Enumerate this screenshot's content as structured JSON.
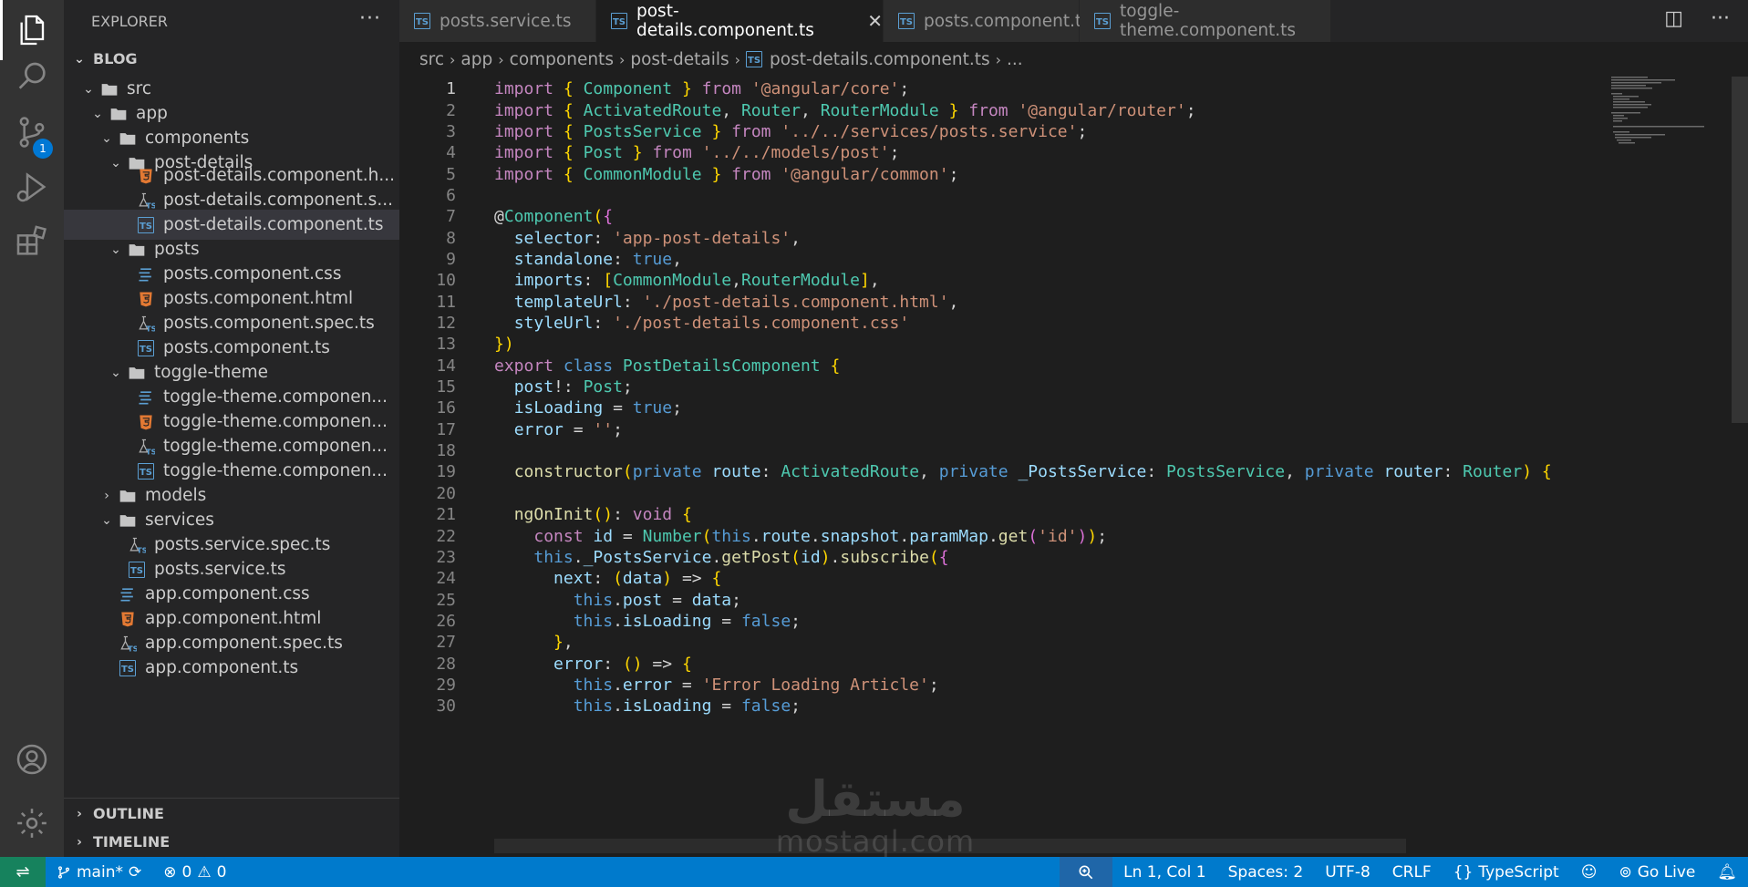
{
  "sidebar": {
    "title": "EXPLORER",
    "more": "···",
    "project": "BLOG",
    "tree": [
      {
        "label": "src",
        "kind": "folder-open"
      },
      {
        "label": "app",
        "kind": "folder-open"
      },
      {
        "label": "components",
        "kind": "folder-open"
      },
      {
        "label": "post-details",
        "kind": "folder-open"
      },
      {
        "label": "post-details.component.h...",
        "kind": "html"
      },
      {
        "label": "post-details.component.s...",
        "kind": "spec"
      },
      {
        "label": "post-details.component.ts",
        "kind": "ts",
        "selected": true
      },
      {
        "label": "posts",
        "kind": "folder-open"
      },
      {
        "label": "posts.component.css",
        "kind": "css"
      },
      {
        "label": "posts.component.html",
        "kind": "html"
      },
      {
        "label": "posts.component.spec.ts",
        "kind": "spec"
      },
      {
        "label": "posts.component.ts",
        "kind": "ts"
      },
      {
        "label": "toggle-theme",
        "kind": "folder-open"
      },
      {
        "label": "toggle-theme.componen...",
        "kind": "css"
      },
      {
        "label": "toggle-theme.componen...",
        "kind": "html"
      },
      {
        "label": "toggle-theme.componen...",
        "kind": "spec"
      },
      {
        "label": "toggle-theme.componen...",
        "kind": "ts"
      },
      {
        "label": "models",
        "kind": "folder-closed"
      },
      {
        "label": "services",
        "kind": "folder-open"
      },
      {
        "label": "posts.service.spec.ts",
        "kind": "spec"
      },
      {
        "label": "posts.service.ts",
        "kind": "ts"
      },
      {
        "label": "app.component.css",
        "kind": "css"
      },
      {
        "label": "app.component.html",
        "kind": "html"
      },
      {
        "label": "app.component.spec.ts",
        "kind": "spec"
      },
      {
        "label": "app.component.ts",
        "kind": "ts"
      }
    ],
    "outline": "OUTLINE",
    "timeline": "TIMELINE"
  },
  "tabs": [
    {
      "label": "posts.service.ts",
      "active": false
    },
    {
      "label": "post-details.component.ts",
      "active": true
    },
    {
      "label": "posts.component.ts",
      "active": false
    },
    {
      "label": "toggle-theme.component.ts",
      "active": false
    }
  ],
  "breadcrumb": [
    "src",
    "app",
    "components",
    "post-details",
    "post-details.component.ts",
    "..."
  ],
  "activity": {
    "scm_badge": "1"
  },
  "code_lines": [
    "import { Component } from '@angular/core';",
    "import { ActivatedRoute, Router, RouterModule } from '@angular/router';",
    "import { PostsService } from '../../services/posts.service';",
    "import { Post } from '../../models/post';",
    "import { CommonModule } from '@angular/common';",
    "",
    "@Component({",
    "  selector: 'app-post-details',",
    "  standalone: true,",
    "  imports: [CommonModule,RouterModule],",
    "  templateUrl: './post-details.component.html',",
    "  styleUrl: './post-details.component.css'",
    "})",
    "export class PostDetailsComponent {",
    "  post!: Post;",
    "  isLoading = true;",
    "  error = '';",
    "",
    "  constructor(private route: ActivatedRoute, private _PostsService: PostsService, private router: Router) {",
    "",
    "  ngOnInit(): void {",
    "    const id = Number(this.route.snapshot.paramMap.get('id'));",
    "    this._PostsService.getPost(id).subscribe({",
    "      next: (data) => {",
    "        this.post = data;",
    "        this.isLoading = false;",
    "      },",
    "      error: () => {",
    "        this.error = 'Error Loading Article';",
    "        this.isLoading = false;"
  ],
  "watermark": {
    "arabic": "مستقل",
    "latin": "mostaql.com"
  },
  "status": {
    "branch": "main*",
    "errors": "0",
    "warnings": "0",
    "cursor": "Ln 1, Col 1",
    "spaces": "Spaces: 2",
    "encoding": "UTF-8",
    "eol": "CRLF",
    "language": "TypeScript",
    "golive": "Go Live"
  },
  "colors": {
    "accent": "#007acc",
    "remote": "#16825d",
    "ts": "#3178c6"
  }
}
